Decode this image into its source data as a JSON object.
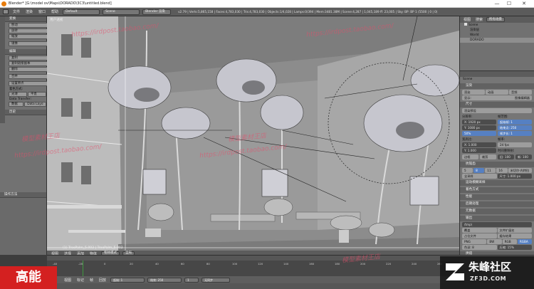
{
  "titlebar": {
    "title": "Blender* [G:\\model ov\\Maps\\DORADO\\3C3\\untitled.blend]",
    "minimize": "—",
    "maximize": "☐",
    "close": "✕"
  },
  "infobar": {
    "menus": [
      "文件",
      "渲染",
      "窗口",
      "帮助"
    ],
    "layout": "Default",
    "scene": "Scene",
    "engine": "Blender 渲染",
    "stats": "v2.79 | Verts:5,865,158 | Faces:4,783,030 | Tris:4,783,030 | Objects:1/4,028 | Lamps:0/394 | Mem:3481.38M | Scene:4,287 | 1,045,189 ff: 23,005 | Sky: BP: BP 1 (5500 | 0 | 0)"
  },
  "toolshelf": {
    "sec_transform": "变换",
    "btn_move": "移动",
    "btn_rotate": "旋转",
    "btn_scale": "缩放",
    "btn_mirror": "镜像",
    "sec_edit": "编辑",
    "btn_duplicate": "复制",
    "btn_duplicate_linked": "复制链接副本",
    "btn_delete": "删除",
    "btn_join": "合并",
    "set_origin": "设置原点",
    "shading_label": "着色方式:",
    "btn_smooth": "光滑",
    "btn_flat": "平直",
    "data_transfer_label": "Data Transfer:",
    "btn_data": "数据",
    "btn_data_layers": "Data Layo",
    "sec_history": "历史",
    "tab_labels": [
      "工具",
      "创建",
      "关系",
      "动画",
      "物理"
    ]
  },
  "operator_panel": {
    "title": "操作方法"
  },
  "viewport": {
    "header_label": "用户透视",
    "footer_object": "(1) TreePalm_5.002 | TreePalm_5.002",
    "mode": "物体模式",
    "view_menu": "视图",
    "select_menu": "选择",
    "add_menu": "添加",
    "object_menu": "物体",
    "global": "全局"
  },
  "outliner": {
    "view": "视图",
    "search": "搜索",
    "filter": "所有场景",
    "rows": [
      "Scene",
      "渲染层",
      "World",
      "DORADO"
    ]
  },
  "properties": {
    "breadcrumb": "Scene",
    "sec_render": "渲染",
    "btn_render": "渲染",
    "btn_animation": "动画",
    "btn_audio": "音频",
    "display_label": "显示:",
    "display_value": "图像编辑器",
    "sec_dimensions": "尺寸",
    "preset": "渲染预设",
    "resolution_label": "分辨率:",
    "res_x": "X: 1920 px",
    "res_y": "Y: 1080 px",
    "res_pct": "50%",
    "frame_range_label": "帧范围:",
    "start": "起始帧: 1",
    "end": "结束点: 250",
    "step": "帧步长: 1",
    "aspect_label": "宽高比:",
    "aspect_x": "X: 1.000",
    "aspect_y": "Y: 1.000",
    "fps_label": "帧率:",
    "fps": "24 fps",
    "time_remap": "时间重映射:",
    "border": "边框",
    "crop": "裁剪",
    "remap_old": "旧: 100",
    "remap_new": "新: 100",
    "sec_antialias": "抗锯齿",
    "aa_samples": [
      "5",
      "8",
      "11",
      "16"
    ],
    "aa_filter": "米切尔-内特拉瓦利",
    "full_sample": "全采样",
    "size": "尺寸: 1.000 px",
    "sec_sampled_motion_blur": "运动模糊采样",
    "sec_shading": "着色方式",
    "sec_performance": "性能",
    "sec_post": "后期处理",
    "sec_metadata": "元数据",
    "sec_output": "输出",
    "output_path": "/tmp\\",
    "overwrite": "覆盖",
    "file_ext": "文件扩展名",
    "placeholders": "占位文件",
    "cache_result": "缓存结果",
    "format": "PNG",
    "bw": "BW",
    "rgb": "RGB",
    "rgba": "RGBA",
    "color_depth": "色深: 8",
    "compression": "压缩: 15%",
    "sec_bake": "烘焙",
    "sec_freestyle": "Freestyle"
  },
  "timeline": {
    "ticks": [
      "-40",
      "-20",
      "0",
      "20",
      "40",
      "60",
      "80",
      "100",
      "120",
      "140",
      "160",
      "180",
      "200",
      "220",
      "240",
      "260"
    ],
    "view": "视图",
    "marker": "标记",
    "frame": "帧",
    "playback": "回放",
    "start": "起始: 1",
    "end": "结束: 250",
    "current": "1",
    "sync": "无同步"
  },
  "overlays": {
    "badge": "高能",
    "brand_name": "朱峰社区",
    "brand_url": "ZF3D.COM",
    "watermark_url": "https://irdpost.taobao.com/",
    "watermark_shop": "模型素材王店"
  },
  "colors": {
    "accent_blue": "#5680c2",
    "badge_red": "#d42020",
    "watermark_pink": "#e64d6a"
  }
}
